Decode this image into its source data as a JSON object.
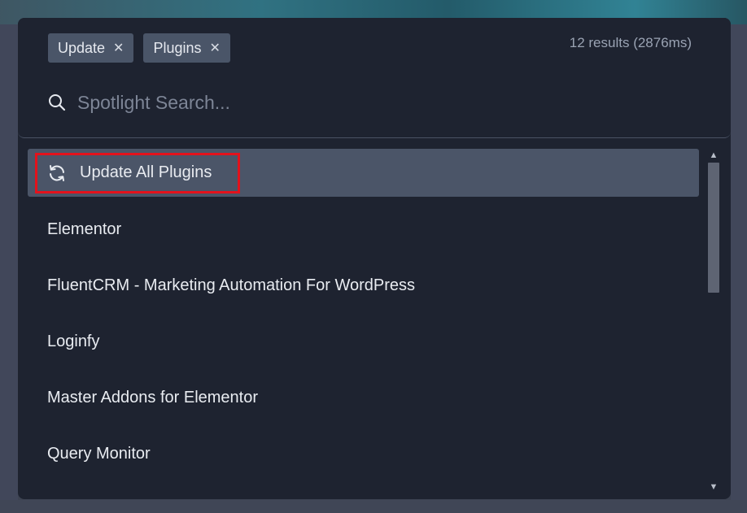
{
  "spotlight": {
    "filters": [
      {
        "label": "Update",
        "close": "✕"
      },
      {
        "label": "Plugins",
        "close": "✕"
      }
    ],
    "results_count": "12 results (2876ms)",
    "search": {
      "placeholder": "Spotlight Search...",
      "value": ""
    },
    "results": [
      {
        "label": "Update All Plugins",
        "icon": "refresh-icon",
        "active": true
      },
      {
        "label": "Elementor"
      },
      {
        "label": "FluentCRM - Marketing Automation For WordPress"
      },
      {
        "label": "Loginfy"
      },
      {
        "label": "Master Addons for Elementor"
      },
      {
        "label": "Query Monitor"
      }
    ],
    "colors": {
      "modal_bg": "#1e2330",
      "chip_bg": "#4a5568",
      "active_row_bg": "#4b5568",
      "highlight_border": "#e3121c"
    }
  }
}
